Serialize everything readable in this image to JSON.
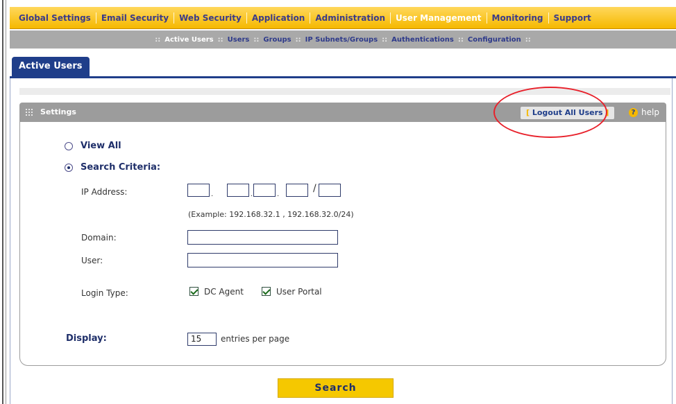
{
  "main_nav": {
    "items": [
      {
        "label": "Global Settings"
      },
      {
        "label": "Email Security"
      },
      {
        "label": "Web Security"
      },
      {
        "label": "Application"
      },
      {
        "label": "Administration"
      },
      {
        "label": "User Management",
        "active": true
      },
      {
        "label": "Monitoring"
      },
      {
        "label": "Support"
      }
    ]
  },
  "sub_nav": {
    "items": [
      {
        "label": "Active Users",
        "active": true
      },
      {
        "label": "Users"
      },
      {
        "label": "Groups"
      },
      {
        "label": "IP Subnets/Groups"
      },
      {
        "label": "Authentications"
      },
      {
        "label": "Configuration"
      }
    ],
    "separator": "::"
  },
  "tab": {
    "label": "Active Users"
  },
  "settings": {
    "title": "Settings",
    "logout_label": "Logout All Users",
    "help_label": "help"
  },
  "form": {
    "view_all_label": "View All",
    "search_criteria_label": "Search Criteria:",
    "ip_address_label": "IP Address:",
    "ip_example": "(Example: 192.168.32.1 , 192.168.32.0/24)",
    "domain_label": "Domain:",
    "user_label": "User:",
    "login_type_label": "Login Type:",
    "dc_agent_label": "DC Agent",
    "user_portal_label": "User Portal",
    "display_label": "Display:",
    "entries_value": "15",
    "entries_suffix": "entries per page"
  },
  "search_button": {
    "label": "Search"
  },
  "colors": {
    "nav_yellow": "#f5b800",
    "nav_text": "#3b3b8a",
    "tab_blue": "#1f3e8a",
    "annotation_red": "#e8202a"
  }
}
